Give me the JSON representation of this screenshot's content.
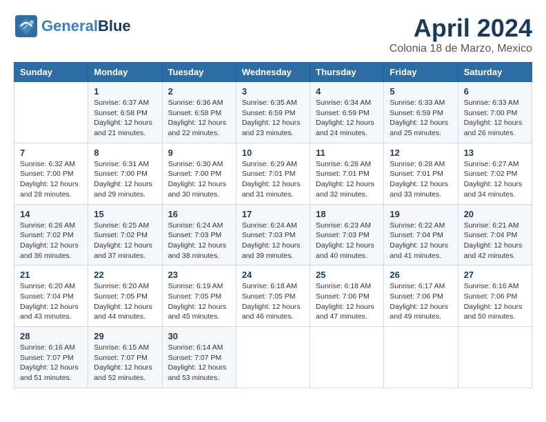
{
  "header": {
    "logo_line1": "General",
    "logo_line2": "Blue",
    "title": "April 2024",
    "subtitle": "Colonia 18 de Marzo, Mexico"
  },
  "weekdays": [
    "Sunday",
    "Monday",
    "Tuesday",
    "Wednesday",
    "Thursday",
    "Friday",
    "Saturday"
  ],
  "weeks": [
    [
      {
        "day": "",
        "info": ""
      },
      {
        "day": "1",
        "info": "Sunrise: 6:37 AM\nSunset: 6:58 PM\nDaylight: 12 hours\nand 21 minutes."
      },
      {
        "day": "2",
        "info": "Sunrise: 6:36 AM\nSunset: 6:58 PM\nDaylight: 12 hours\nand 22 minutes."
      },
      {
        "day": "3",
        "info": "Sunrise: 6:35 AM\nSunset: 6:59 PM\nDaylight: 12 hours\nand 23 minutes."
      },
      {
        "day": "4",
        "info": "Sunrise: 6:34 AM\nSunset: 6:59 PM\nDaylight: 12 hours\nand 24 minutes."
      },
      {
        "day": "5",
        "info": "Sunrise: 6:33 AM\nSunset: 6:59 PM\nDaylight: 12 hours\nand 25 minutes."
      },
      {
        "day": "6",
        "info": "Sunrise: 6:33 AM\nSunset: 7:00 PM\nDaylight: 12 hours\nand 26 minutes."
      }
    ],
    [
      {
        "day": "7",
        "info": "Sunrise: 6:32 AM\nSunset: 7:00 PM\nDaylight: 12 hours\nand 28 minutes."
      },
      {
        "day": "8",
        "info": "Sunrise: 6:31 AM\nSunset: 7:00 PM\nDaylight: 12 hours\nand 29 minutes."
      },
      {
        "day": "9",
        "info": "Sunrise: 6:30 AM\nSunset: 7:00 PM\nDaylight: 12 hours\nand 30 minutes."
      },
      {
        "day": "10",
        "info": "Sunrise: 6:29 AM\nSunset: 7:01 PM\nDaylight: 12 hours\nand 31 minutes."
      },
      {
        "day": "11",
        "info": "Sunrise: 6:28 AM\nSunset: 7:01 PM\nDaylight: 12 hours\nand 32 minutes."
      },
      {
        "day": "12",
        "info": "Sunrise: 6:28 AM\nSunset: 7:01 PM\nDaylight: 12 hours\nand 33 minutes."
      },
      {
        "day": "13",
        "info": "Sunrise: 6:27 AM\nSunset: 7:02 PM\nDaylight: 12 hours\nand 34 minutes."
      }
    ],
    [
      {
        "day": "14",
        "info": "Sunrise: 6:26 AM\nSunset: 7:02 PM\nDaylight: 12 hours\nand 36 minutes."
      },
      {
        "day": "15",
        "info": "Sunrise: 6:25 AM\nSunset: 7:02 PM\nDaylight: 12 hours\nand 37 minutes."
      },
      {
        "day": "16",
        "info": "Sunrise: 6:24 AM\nSunset: 7:03 PM\nDaylight: 12 hours\nand 38 minutes."
      },
      {
        "day": "17",
        "info": "Sunrise: 6:24 AM\nSunset: 7:03 PM\nDaylight: 12 hours\nand 39 minutes."
      },
      {
        "day": "18",
        "info": "Sunrise: 6:23 AM\nSunset: 7:03 PM\nDaylight: 12 hours\nand 40 minutes."
      },
      {
        "day": "19",
        "info": "Sunrise: 6:22 AM\nSunset: 7:04 PM\nDaylight: 12 hours\nand 41 minutes."
      },
      {
        "day": "20",
        "info": "Sunrise: 6:21 AM\nSunset: 7:04 PM\nDaylight: 12 hours\nand 42 minutes."
      }
    ],
    [
      {
        "day": "21",
        "info": "Sunrise: 6:20 AM\nSunset: 7:04 PM\nDaylight: 12 hours\nand 43 minutes."
      },
      {
        "day": "22",
        "info": "Sunrise: 6:20 AM\nSunset: 7:05 PM\nDaylight: 12 hours\nand 44 minutes."
      },
      {
        "day": "23",
        "info": "Sunrise: 6:19 AM\nSunset: 7:05 PM\nDaylight: 12 hours\nand 45 minutes."
      },
      {
        "day": "24",
        "info": "Sunrise: 6:18 AM\nSunset: 7:05 PM\nDaylight: 12 hours\nand 46 minutes."
      },
      {
        "day": "25",
        "info": "Sunrise: 6:18 AM\nSunset: 7:06 PM\nDaylight: 12 hours\nand 47 minutes."
      },
      {
        "day": "26",
        "info": "Sunrise: 6:17 AM\nSunset: 7:06 PM\nDaylight: 12 hours\nand 49 minutes."
      },
      {
        "day": "27",
        "info": "Sunrise: 6:16 AM\nSunset: 7:06 PM\nDaylight: 12 hours\nand 50 minutes."
      }
    ],
    [
      {
        "day": "28",
        "info": "Sunrise: 6:16 AM\nSunset: 7:07 PM\nDaylight: 12 hours\nand 51 minutes."
      },
      {
        "day": "29",
        "info": "Sunrise: 6:15 AM\nSunset: 7:07 PM\nDaylight: 12 hours\nand 52 minutes."
      },
      {
        "day": "30",
        "info": "Sunrise: 6:14 AM\nSunset: 7:07 PM\nDaylight: 12 hours\nand 53 minutes."
      },
      {
        "day": "",
        "info": ""
      },
      {
        "day": "",
        "info": ""
      },
      {
        "day": "",
        "info": ""
      },
      {
        "day": "",
        "info": ""
      }
    ]
  ]
}
